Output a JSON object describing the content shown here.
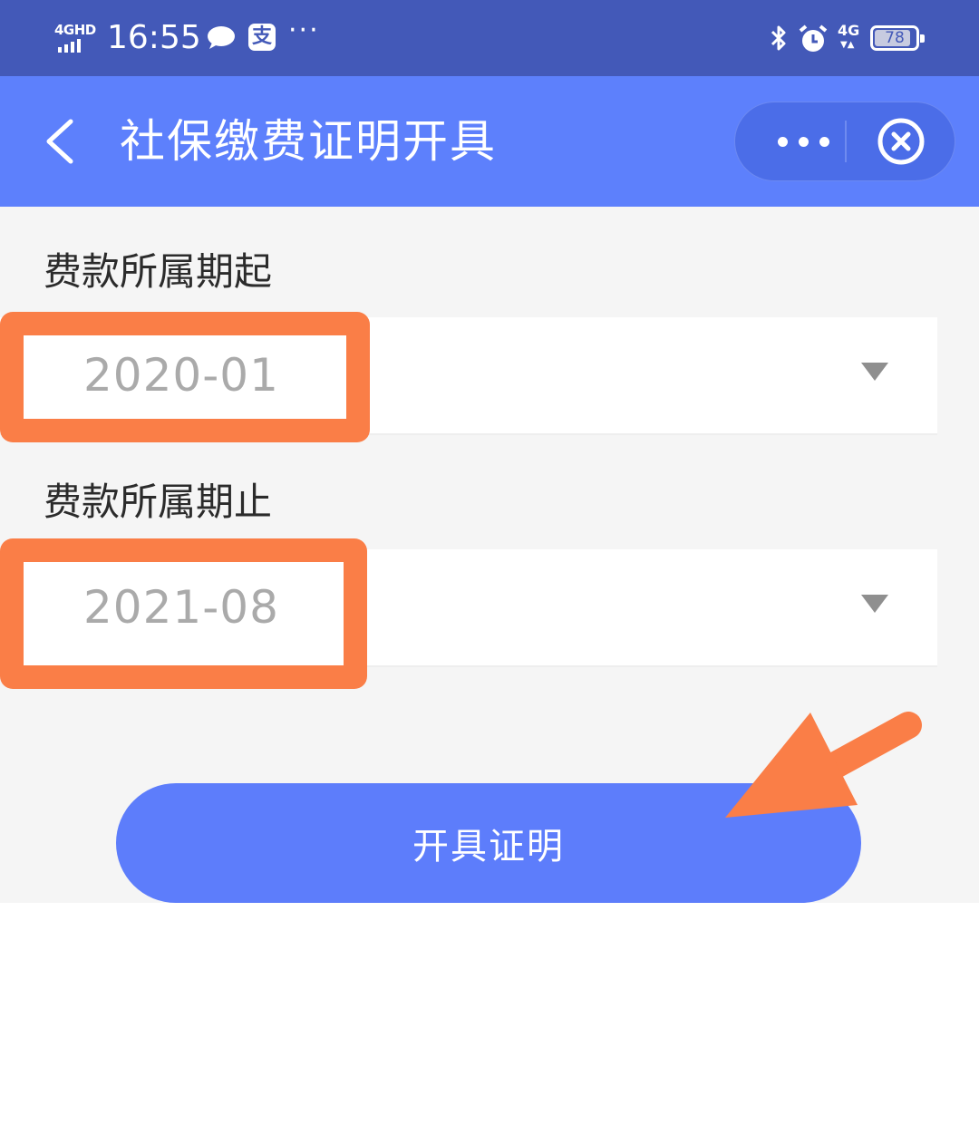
{
  "status_bar": {
    "network_label": "4GHD",
    "time": "16:55",
    "more_glyph": "···",
    "pay_icon_glyph": "支",
    "mobile_data": "4G",
    "battery_level": "78"
  },
  "nav": {
    "title": "社保缴费证明开具"
  },
  "form": {
    "start": {
      "label": "费款所属期起",
      "value": "2020-01"
    },
    "end": {
      "label": "费款所属期止",
      "value": "2021-08"
    },
    "submit_label": "开具证明"
  },
  "colors": {
    "status_bar": "#4359b8",
    "nav_bar": "#5d80fc",
    "button": "#5d7dfb",
    "annotation": "#fa7e47",
    "page_bg": "#f5f5f5"
  }
}
